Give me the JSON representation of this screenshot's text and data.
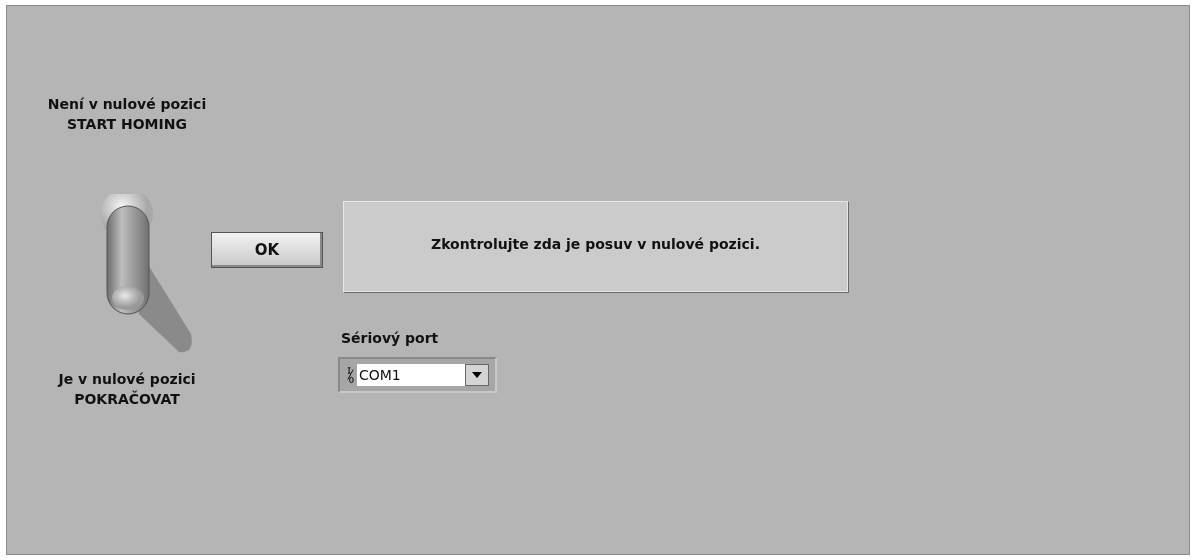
{
  "toggle": {
    "label_top": [
      "Není v nulové pozici",
      "START HOMING"
    ],
    "label_bottom": [
      "Je v nulové pozici",
      "POKRAČOVAT"
    ],
    "up": false
  },
  "ok_button": {
    "label": "OK"
  },
  "message": "Zkontrolujte zda je posuv v nulové pozici.",
  "serial_port": {
    "label": "Sériový port",
    "value": "COM1"
  }
}
